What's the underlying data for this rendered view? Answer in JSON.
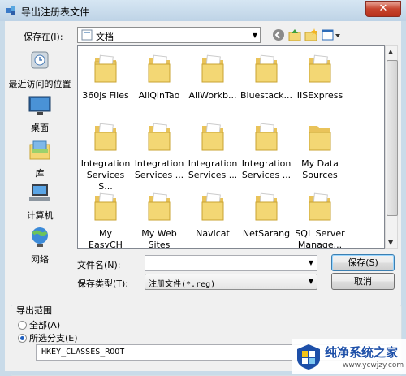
{
  "window": {
    "title": "导出注册表文件",
    "close_label": "✕"
  },
  "toolbar": {
    "look_in_label": "保存在(I):",
    "look_in_value": "文档"
  },
  "places": [
    {
      "label": "最近访问的位置",
      "icon": "recent-places-icon"
    },
    {
      "label": "桌面",
      "icon": "desktop-icon"
    },
    {
      "label": "库",
      "icon": "libraries-icon"
    },
    {
      "label": "计算机",
      "icon": "computer-icon"
    },
    {
      "label": "网络",
      "icon": "network-icon"
    }
  ],
  "files": [
    {
      "line1": "360js Files",
      "line2": ""
    },
    {
      "line1": "AliQinTao",
      "line2": ""
    },
    {
      "line1": "AliWorkb...",
      "line2": ""
    },
    {
      "line1": "Bluestack...",
      "line2": ""
    },
    {
      "line1": "IISExpress",
      "line2": ""
    },
    {
      "line1": "Integration",
      "line2": "Services S..."
    },
    {
      "line1": "Integration",
      "line2": "Services ..."
    },
    {
      "line1": "Integration",
      "line2": "Services ..."
    },
    {
      "line1": "Integration",
      "line2": "Services ..."
    },
    {
      "line1": "My Data",
      "line2": "Sources"
    },
    {
      "line1": "My",
      "line2": "EasyCH"
    },
    {
      "line1": "My Web",
      "line2": "Sites"
    },
    {
      "line1": "Navicat",
      "line2": ""
    },
    {
      "line1": "NetSarang",
      "line2": ""
    },
    {
      "line1": "SQL Server",
      "line2": "Manage..."
    }
  ],
  "form": {
    "filename_label": "文件名(N):",
    "filename_value": "",
    "filetype_label": "保存类型(T):",
    "filetype_value": "注册文件(*.reg)",
    "save_label": "保存(S)",
    "cancel_label": "取消"
  },
  "export_range": {
    "title": "导出范围",
    "all_label": "全部(A)",
    "branch_label": "所选分支(E)",
    "selected": "branch",
    "branch_value": "HKEY_CLASSES_ROOT"
  },
  "watermark": {
    "title": "纯净系统之家",
    "url": "www.ycwjzy.com"
  },
  "colors": {
    "folder": "#f3d774",
    "accent": "#1d4fa8",
    "close": "#c7452f"
  }
}
